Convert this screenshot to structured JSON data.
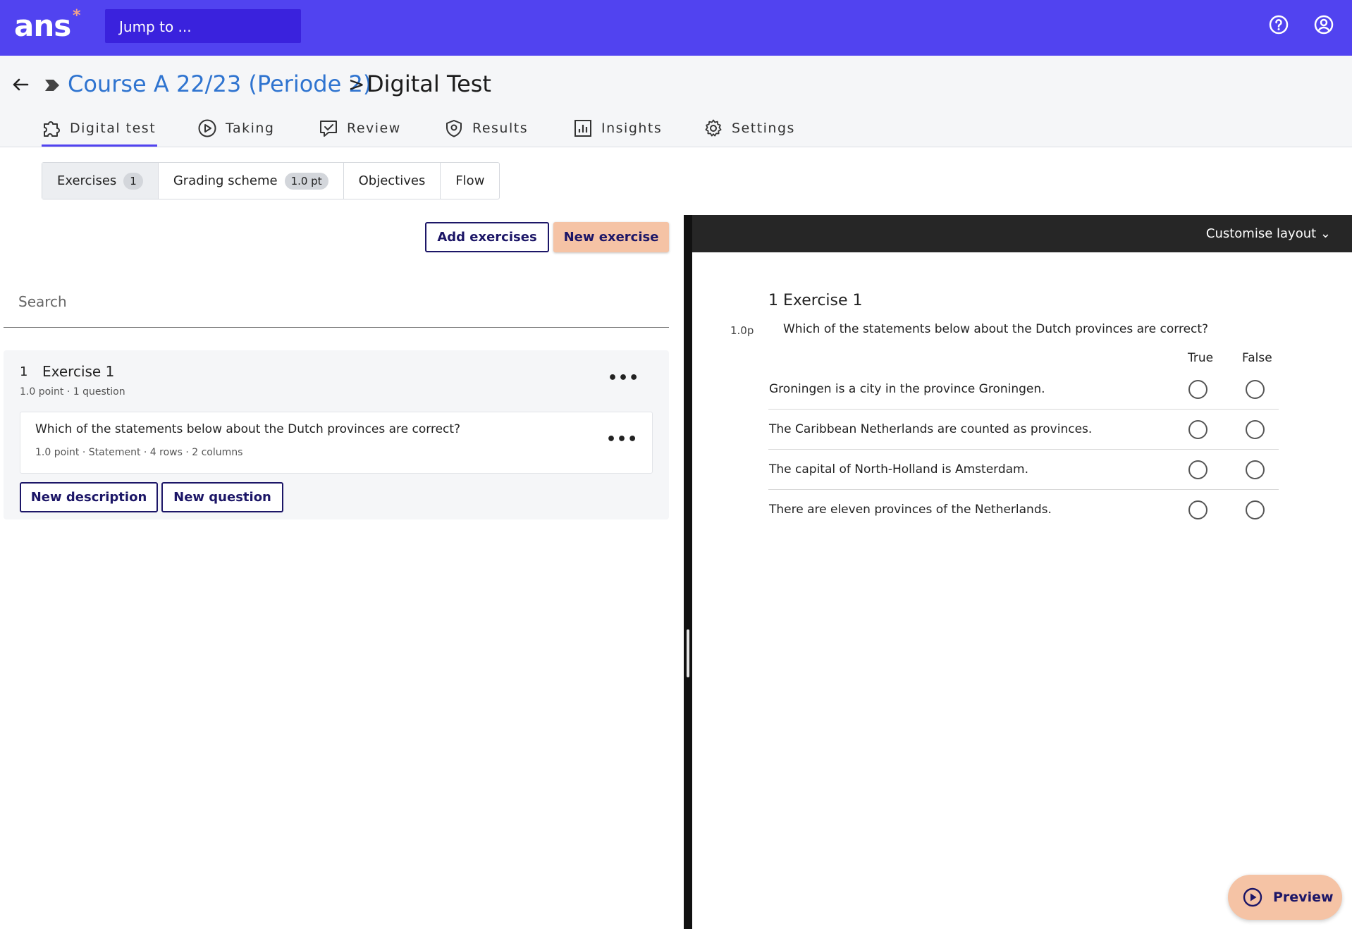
{
  "app": {
    "logo": "ans",
    "logo_mark": "*",
    "jump_placeholder": "Jump to ..."
  },
  "breadcrumb": {
    "course": "Course A 22/23 (Periode 2)",
    "separator": ">",
    "title": "Digital Test"
  },
  "tabs": [
    {
      "label": "Digital test",
      "icon": "puzzle-icon",
      "active": true
    },
    {
      "label": "Taking",
      "icon": "play-circle-icon"
    },
    {
      "label": "Review",
      "icon": "review-icon"
    },
    {
      "label": "Results",
      "icon": "shield-icon"
    },
    {
      "label": "Insights",
      "icon": "chart-icon"
    },
    {
      "label": "Settings",
      "icon": "gear-icon"
    }
  ],
  "subtabs": [
    {
      "label": "Exercises",
      "badge": "1",
      "active": true
    },
    {
      "label": "Grading scheme",
      "badge": "1.0 pt"
    },
    {
      "label": "Objectives"
    },
    {
      "label": "Flow"
    }
  ],
  "actions": {
    "add_exercises": "Add exercises",
    "new_exercise": "New exercise"
  },
  "search": {
    "placeholder": "Search"
  },
  "exercise": {
    "number": "1",
    "title": "Exercise 1",
    "meta": "1.0 point · 1 question",
    "question": {
      "text": "Which of the statements below about the Dutch provinces are correct?",
      "meta": "1.0 point · Statement · 4 rows · 2 columns"
    },
    "new_description": "New description",
    "new_question": "New question"
  },
  "preview_panel": {
    "customise": "Customise layout",
    "exercise_title": "1 Exercise 1",
    "points": "1.0p",
    "question": "Which of the statements below about the Dutch provinces are correct?",
    "columns": [
      "True",
      "False"
    ],
    "statements": [
      "Groningen is a city in the province Groningen.",
      "The Caribbean Netherlands are counted as provinces.",
      "The capital of North-Holland is Amsterdam.",
      "There are eleven provinces of the Netherlands."
    ]
  },
  "preview_button": "Preview",
  "colors": {
    "brand": "#5143f0",
    "accent": "#f5c3a5",
    "link": "#2f74d0",
    "navy": "#1c1667"
  }
}
